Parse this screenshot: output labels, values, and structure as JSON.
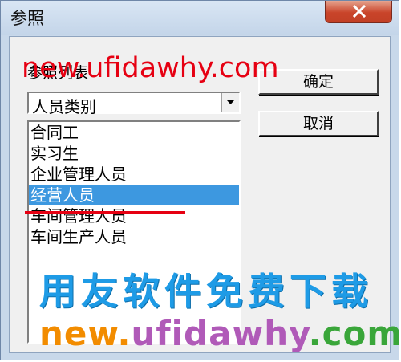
{
  "window": {
    "title": "参照"
  },
  "reference_list": {
    "label": "参照列表",
    "combo_value": "人员类别",
    "items": [
      {
        "label": "合同工",
        "selected": false
      },
      {
        "label": "实习生",
        "selected": false
      },
      {
        "label": "企业管理人员",
        "selected": false
      },
      {
        "label": "经营人员",
        "selected": true
      },
      {
        "label": "车间管理人员",
        "selected": false
      },
      {
        "label": "车间生产人员",
        "selected": false
      }
    ]
  },
  "buttons": {
    "ok_label": "确定",
    "cancel_label": "取消"
  },
  "watermark": {
    "top_text": "new.ufidawhy.com",
    "cn_text": "用友软件免费下载",
    "bottom_parts": [
      "new.",
      "ufidawhy",
      ".com"
    ]
  },
  "colors": {
    "selection": "#3d98e0",
    "watermark_red": "#e60012",
    "watermark_blue": "#1e9be6",
    "watermark_orange": "#f28c00",
    "watermark_purple": "#b05ab8",
    "watermark_green": "#3aa63a"
  }
}
